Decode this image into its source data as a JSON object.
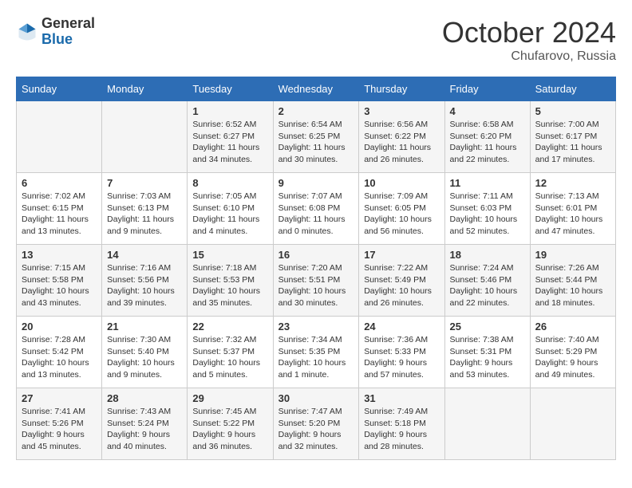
{
  "header": {
    "logo_general": "General",
    "logo_blue": "Blue",
    "month_title": "October 2024",
    "location": "Chufarovo, Russia"
  },
  "weekdays": [
    "Sunday",
    "Monday",
    "Tuesday",
    "Wednesday",
    "Thursday",
    "Friday",
    "Saturday"
  ],
  "weeks": [
    [
      {
        "day": "",
        "info": ""
      },
      {
        "day": "",
        "info": ""
      },
      {
        "day": "1",
        "info": "Sunrise: 6:52 AM\nSunset: 6:27 PM\nDaylight: 11 hours\nand 34 minutes."
      },
      {
        "day": "2",
        "info": "Sunrise: 6:54 AM\nSunset: 6:25 PM\nDaylight: 11 hours\nand 30 minutes."
      },
      {
        "day": "3",
        "info": "Sunrise: 6:56 AM\nSunset: 6:22 PM\nDaylight: 11 hours\nand 26 minutes."
      },
      {
        "day": "4",
        "info": "Sunrise: 6:58 AM\nSunset: 6:20 PM\nDaylight: 11 hours\nand 22 minutes."
      },
      {
        "day": "5",
        "info": "Sunrise: 7:00 AM\nSunset: 6:17 PM\nDaylight: 11 hours\nand 17 minutes."
      }
    ],
    [
      {
        "day": "6",
        "info": "Sunrise: 7:02 AM\nSunset: 6:15 PM\nDaylight: 11 hours\nand 13 minutes."
      },
      {
        "day": "7",
        "info": "Sunrise: 7:03 AM\nSunset: 6:13 PM\nDaylight: 11 hours\nand 9 minutes."
      },
      {
        "day": "8",
        "info": "Sunrise: 7:05 AM\nSunset: 6:10 PM\nDaylight: 11 hours\nand 4 minutes."
      },
      {
        "day": "9",
        "info": "Sunrise: 7:07 AM\nSunset: 6:08 PM\nDaylight: 11 hours\nand 0 minutes."
      },
      {
        "day": "10",
        "info": "Sunrise: 7:09 AM\nSunset: 6:05 PM\nDaylight: 10 hours\nand 56 minutes."
      },
      {
        "day": "11",
        "info": "Sunrise: 7:11 AM\nSunset: 6:03 PM\nDaylight: 10 hours\nand 52 minutes."
      },
      {
        "day": "12",
        "info": "Sunrise: 7:13 AM\nSunset: 6:01 PM\nDaylight: 10 hours\nand 47 minutes."
      }
    ],
    [
      {
        "day": "13",
        "info": "Sunrise: 7:15 AM\nSunset: 5:58 PM\nDaylight: 10 hours\nand 43 minutes."
      },
      {
        "day": "14",
        "info": "Sunrise: 7:16 AM\nSunset: 5:56 PM\nDaylight: 10 hours\nand 39 minutes."
      },
      {
        "day": "15",
        "info": "Sunrise: 7:18 AM\nSunset: 5:53 PM\nDaylight: 10 hours\nand 35 minutes."
      },
      {
        "day": "16",
        "info": "Sunrise: 7:20 AM\nSunset: 5:51 PM\nDaylight: 10 hours\nand 30 minutes."
      },
      {
        "day": "17",
        "info": "Sunrise: 7:22 AM\nSunset: 5:49 PM\nDaylight: 10 hours\nand 26 minutes."
      },
      {
        "day": "18",
        "info": "Sunrise: 7:24 AM\nSunset: 5:46 PM\nDaylight: 10 hours\nand 22 minutes."
      },
      {
        "day": "19",
        "info": "Sunrise: 7:26 AM\nSunset: 5:44 PM\nDaylight: 10 hours\nand 18 minutes."
      }
    ],
    [
      {
        "day": "20",
        "info": "Sunrise: 7:28 AM\nSunset: 5:42 PM\nDaylight: 10 hours\nand 13 minutes."
      },
      {
        "day": "21",
        "info": "Sunrise: 7:30 AM\nSunset: 5:40 PM\nDaylight: 10 hours\nand 9 minutes."
      },
      {
        "day": "22",
        "info": "Sunrise: 7:32 AM\nSunset: 5:37 PM\nDaylight: 10 hours\nand 5 minutes."
      },
      {
        "day": "23",
        "info": "Sunrise: 7:34 AM\nSunset: 5:35 PM\nDaylight: 10 hours\nand 1 minute."
      },
      {
        "day": "24",
        "info": "Sunrise: 7:36 AM\nSunset: 5:33 PM\nDaylight: 9 hours\nand 57 minutes."
      },
      {
        "day": "25",
        "info": "Sunrise: 7:38 AM\nSunset: 5:31 PM\nDaylight: 9 hours\nand 53 minutes."
      },
      {
        "day": "26",
        "info": "Sunrise: 7:40 AM\nSunset: 5:29 PM\nDaylight: 9 hours\nand 49 minutes."
      }
    ],
    [
      {
        "day": "27",
        "info": "Sunrise: 7:41 AM\nSunset: 5:26 PM\nDaylight: 9 hours\nand 45 minutes."
      },
      {
        "day": "28",
        "info": "Sunrise: 7:43 AM\nSunset: 5:24 PM\nDaylight: 9 hours\nand 40 minutes."
      },
      {
        "day": "29",
        "info": "Sunrise: 7:45 AM\nSunset: 5:22 PM\nDaylight: 9 hours\nand 36 minutes."
      },
      {
        "day": "30",
        "info": "Sunrise: 7:47 AM\nSunset: 5:20 PM\nDaylight: 9 hours\nand 32 minutes."
      },
      {
        "day": "31",
        "info": "Sunrise: 7:49 AM\nSunset: 5:18 PM\nDaylight: 9 hours\nand 28 minutes."
      },
      {
        "day": "",
        "info": ""
      },
      {
        "day": "",
        "info": ""
      }
    ]
  ]
}
